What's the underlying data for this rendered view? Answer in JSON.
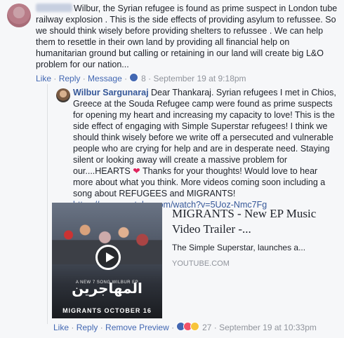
{
  "comment1": {
    "author_name": "",
    "text": "Wilbur, the Syrian refugee is found as prime suspect in London tube railway explosion . This is the side effects of providing asylum to refussee. So we should think wisely before providing shelters to refussee . We can help them to resettle in their own land by providing all financial help on humanitarian ground but calling or retaining in our land will create big L&O problem for our nation...",
    "actions": {
      "like": "Like",
      "reply": "Reply",
      "message": "Message"
    },
    "reaction_count": "8",
    "timestamp": "September 19 at 9:18pm"
  },
  "comment2": {
    "author_name": "Wilbur Sargunaraj",
    "text_part1": "Dear Thankaraj. Syrian refugees I met in Chios, Greece at the Souda Refugee camp were found as prime suspects for opening my heart and increasing my capacity to love! This is the side effect of engaging with Simple Superstar refugees! I think we should think wisely before we write off a persecuted and vulnerable people who are crying for help and are in desperate need. Staying silent or looking away will create a massive problem for our....HEARTS",
    "heart": "❤",
    "text_part2": "Thanks for your thoughts! Would love to hear more about what you think. More videos coming soon including a song about REFUGEES and MIGRANTS!",
    "link": "https://www.youtube.com/watch?v=5Uoz-Nmc7Fg",
    "actions": {
      "like": "Like",
      "reply": "Reply",
      "remove_preview": "Remove Preview"
    },
    "reaction_count": "27",
    "timestamp": "September 19 at 10:33pm"
  },
  "preview": {
    "title": "MIGRANTS - New EP Music Video Trailer -...",
    "description": "The Simple Superstar, launches a...",
    "source": "YOUTUBE.COM",
    "thumb_subtitle": "A NEW 7 SONG WILBUR EP",
    "thumb_arabic": "المهاجرين",
    "thumb_date": "MIGRANTS OCTOBER 16"
  },
  "separator": " · "
}
